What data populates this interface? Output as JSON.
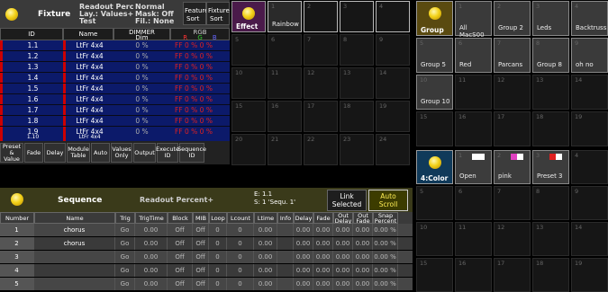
{
  "fixture": {
    "title": "Fixture",
    "info_col1": [
      "Readout Perc",
      "Lay.: Values+",
      "Test"
    ],
    "info_col2": [
      "Normal",
      "Mask: Off",
      "Fil.: None"
    ],
    "sort1": [
      "Feature",
      "Sort"
    ],
    "sort2": [
      "Fixture",
      "Sort"
    ],
    "columns": {
      "id": "ID",
      "name": "Name",
      "dimmer": "DIMMER",
      "dimmer_sub": "Dim",
      "rgb": "RGB",
      "r": "R",
      "g": "G",
      "b": "B"
    },
    "rows": [
      {
        "id": "1.1",
        "name": "LtFr 4x4",
        "dim": "0 %",
        "rgb": "FF  0 %  0 %"
      },
      {
        "id": "1.2",
        "name": "LtFr 4x4",
        "dim": "0 %",
        "rgb": "FF  0 %  0 %"
      },
      {
        "id": "1.3",
        "name": "LtFr 4x4",
        "dim": "0 %",
        "rgb": "FF  0 %  0 %"
      },
      {
        "id": "1.4",
        "name": "LtFr 4x4",
        "dim": "0 %",
        "rgb": "FF  0 %  0 %"
      },
      {
        "id": "1.5",
        "name": "LtFr 4x4",
        "dim": "0 %",
        "rgb": "FF  0 %  0 %"
      },
      {
        "id": "1.6",
        "name": "LtFr 4x4",
        "dim": "0 %",
        "rgb": "FF  0 %  0 %"
      },
      {
        "id": "1.7",
        "name": "LtFr 4x4",
        "dim": "0 %",
        "rgb": "FF  0 %  0 %"
      },
      {
        "id": "1.8",
        "name": "LtFr 4x4",
        "dim": "0 %",
        "rgb": "FF  0 %  0 %"
      },
      {
        "id": "1.9",
        "name": "LtFr 4x4",
        "dim": "0 %",
        "rgb": "FF  0 %  0 %"
      }
    ],
    "buttons": [
      "Preset & Value",
      "Fade",
      "Delay",
      "Module Table",
      "Auto",
      "Values Only",
      "Output",
      "Execute ID",
      "Sequence ID"
    ]
  },
  "sequence": {
    "title": "Sequence",
    "readout": "Readout Percent+",
    "exec": "E:  1.1",
    "seq": "S:  1 'Sequ. 1'",
    "link": [
      "Link",
      "Selected"
    ],
    "autoscroll": [
      "Auto",
      "Scroll"
    ],
    "columns": [
      "Number",
      "Name",
      "Trig",
      "TrigTime",
      "Block",
      "MIB",
      "Loop",
      "Lcount",
      "Ltime",
      "Info",
      "Delay",
      "Fade",
      "Out Delay",
      "Out Fade",
      "Snap Percent"
    ],
    "rows": [
      [
        "1",
        "chorus",
        "Go",
        "0.00",
        "Off",
        "Off",
        "0",
        "0",
        "0.00",
        "",
        "0.00",
        "0.00",
        "0.00",
        "0.00",
        "0.00 %"
      ],
      [
        "2",
        "chorus",
        "Go",
        "0.00",
        "Off",
        "Off",
        "0",
        "0",
        "0.00",
        "",
        "0.00",
        "0.00",
        "0.00",
        "0.00",
        "0.00 %"
      ],
      [
        "3",
        "",
        "Go",
        "0.00",
        "Off",
        "Off",
        "0",
        "0",
        "0.00",
        "",
        "0.00",
        "0.00",
        "0.00",
        "0.00",
        "0.00 %"
      ],
      [
        "4",
        "",
        "Go",
        "0.00",
        "Off",
        "Off",
        "0",
        "0",
        "0.00",
        "",
        "0.00",
        "0.00",
        "0.00",
        "0.00",
        "0.00 %"
      ],
      [
        "5",
        "",
        "Go",
        "0.00",
        "Off",
        "Off",
        "0",
        "0",
        "0.00",
        "",
        "0.00",
        "0.00",
        "0.00",
        "0.00",
        "0.00 %"
      ]
    ]
  },
  "effect": {
    "title": "Effect",
    "cells": [
      {
        "n": "1",
        "label": "Rainbow"
      },
      {
        "n": "2",
        "label": ""
      },
      {
        "n": "3",
        "label": ""
      },
      {
        "n": "4",
        "label": ""
      },
      {
        "n": "5",
        "label": ""
      },
      {
        "n": "6",
        "label": ""
      },
      {
        "n": "7",
        "label": ""
      },
      {
        "n": "8",
        "label": ""
      },
      {
        "n": "9",
        "label": ""
      },
      {
        "n": "10",
        "label": ""
      },
      {
        "n": "11",
        "label": ""
      },
      {
        "n": "12",
        "label": ""
      },
      {
        "n": "13",
        "label": ""
      },
      {
        "n": "14",
        "label": ""
      },
      {
        "n": "15",
        "label": ""
      },
      {
        "n": "16",
        "label": ""
      },
      {
        "n": "17",
        "label": ""
      },
      {
        "n": "18",
        "label": ""
      },
      {
        "n": "19",
        "label": ""
      },
      {
        "n": "20",
        "label": ""
      },
      {
        "n": "21",
        "label": ""
      },
      {
        "n": "22",
        "label": ""
      },
      {
        "n": "23",
        "label": ""
      },
      {
        "n": "24",
        "label": ""
      }
    ]
  },
  "group": {
    "title": "Group",
    "cells": [
      {
        "n": "1",
        "label": "All MacS00"
      },
      {
        "n": "2",
        "label": "Group 2"
      },
      {
        "n": "3",
        "label": "Leds"
      },
      {
        "n": "4",
        "label": "Backtruss"
      },
      {
        "n": "5",
        "label": "Group 5"
      },
      {
        "n": "6",
        "label": "Red"
      },
      {
        "n": "7",
        "label": "Parcans"
      },
      {
        "n": "8",
        "label": "Group 8"
      },
      {
        "n": "9",
        "label": "oh no"
      },
      {
        "n": "10",
        "label": "Group 10"
      },
      {
        "n": "11",
        "label": ""
      },
      {
        "n": "12",
        "label": ""
      },
      {
        "n": "13",
        "label": ""
      },
      {
        "n": "14",
        "label": ""
      },
      {
        "n": "15",
        "label": ""
      },
      {
        "n": "16",
        "label": ""
      },
      {
        "n": "17",
        "label": ""
      },
      {
        "n": "18",
        "label": ""
      },
      {
        "n": "19",
        "label": ""
      }
    ]
  },
  "color": {
    "title": "4:Color",
    "cells": [
      {
        "n": "1",
        "label": "Open"
      },
      {
        "n": "2",
        "label": "pink"
      },
      {
        "n": "3",
        "label": "Preset 3"
      },
      {
        "n": "4",
        "label": ""
      },
      {
        "n": "5",
        "label": ""
      },
      {
        "n": "6",
        "label": ""
      },
      {
        "n": "7",
        "label": ""
      },
      {
        "n": "8",
        "label": ""
      },
      {
        "n": "9",
        "label": ""
      },
      {
        "n": "10",
        "label": ""
      },
      {
        "n": "11",
        "label": ""
      },
      {
        "n": "12",
        "label": ""
      },
      {
        "n": "13",
        "label": ""
      },
      {
        "n": "14",
        "label": ""
      },
      {
        "n": "15",
        "label": ""
      },
      {
        "n": "16",
        "label": ""
      },
      {
        "n": "17",
        "label": ""
      },
      {
        "n": "18",
        "label": ""
      },
      {
        "n": "19",
        "label": ""
      }
    ]
  },
  "colors": {
    "accent_red": "#e02020",
    "row_blue": "#0c1a6a",
    "effect_purple": "#6a2a6a",
    "group_gold": "#7a6a20",
    "color_teal": "#1c5a7a"
  }
}
